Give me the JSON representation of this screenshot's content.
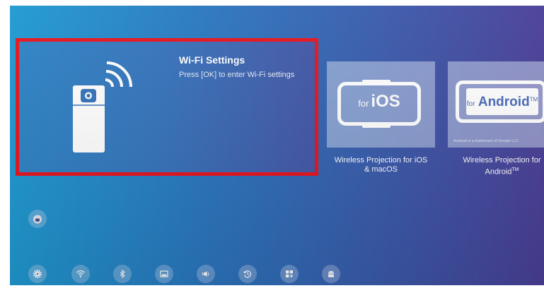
{
  "wifi_card": {
    "title": "Wi-Fi Settings",
    "description": "Press [OK] to enter Wi-Fi settings",
    "focused": true,
    "focus_color": "#e8141e"
  },
  "apps": [
    {
      "logo_small": "for",
      "logo_big": "iOS",
      "caption_line1": "Wireless Projection for iOS",
      "caption_line2": "& macOS"
    },
    {
      "logo_small": "for",
      "logo_big": "Android",
      "logo_tm": "TM",
      "trademark_note": "Android is a trademark of Google LLC",
      "caption_line1": "Wireless Projection for",
      "caption_line2": "Android",
      "caption_tm": "TM"
    }
  ],
  "icons": {
    "shortcut": "badge-icon",
    "bottom_row": [
      "settings-gear-icon",
      "wifi-icon",
      "bluetooth-icon",
      "image-icon",
      "speaker-icon",
      "history-icon",
      "apps-grid-icon",
      "android-robot-icon"
    ]
  },
  "colors": {
    "background_start": "#1f9ad2",
    "background_end": "#4a3f97",
    "text": "#ffffff"
  }
}
